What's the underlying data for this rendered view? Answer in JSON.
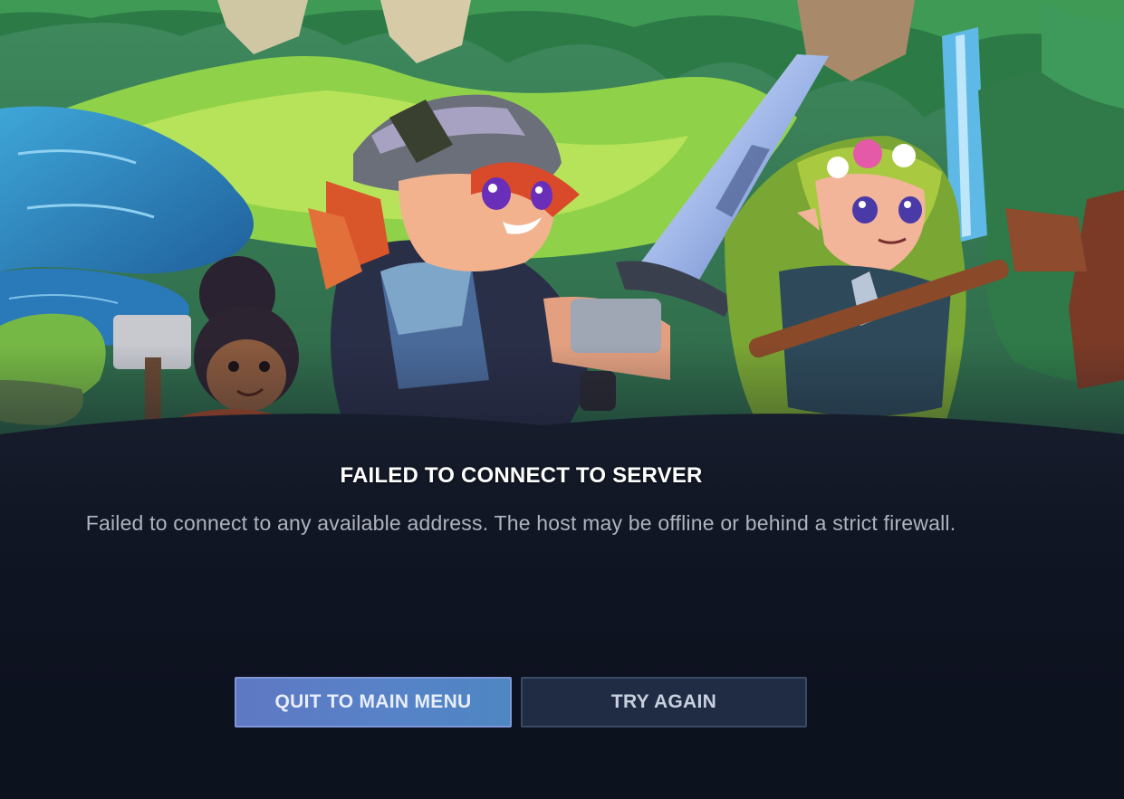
{
  "dialog": {
    "title": "FAILED TO CONNECT TO SERVER",
    "message": "Failed to connect to any available address. The host may be offline or behind a strict firewall."
  },
  "buttons": {
    "quit_label": "QUIT TO MAIN MENU",
    "retry_label": "TRY AGAIN"
  },
  "colors": {
    "background": "#0f1422",
    "primary_button": "#5a7cc6",
    "secondary_button": "#1f2c44",
    "title_text": "#ffffff",
    "message_text": "#aeb3bd"
  },
  "artwork": {
    "subject": "key-art-heroes-in-forest"
  }
}
